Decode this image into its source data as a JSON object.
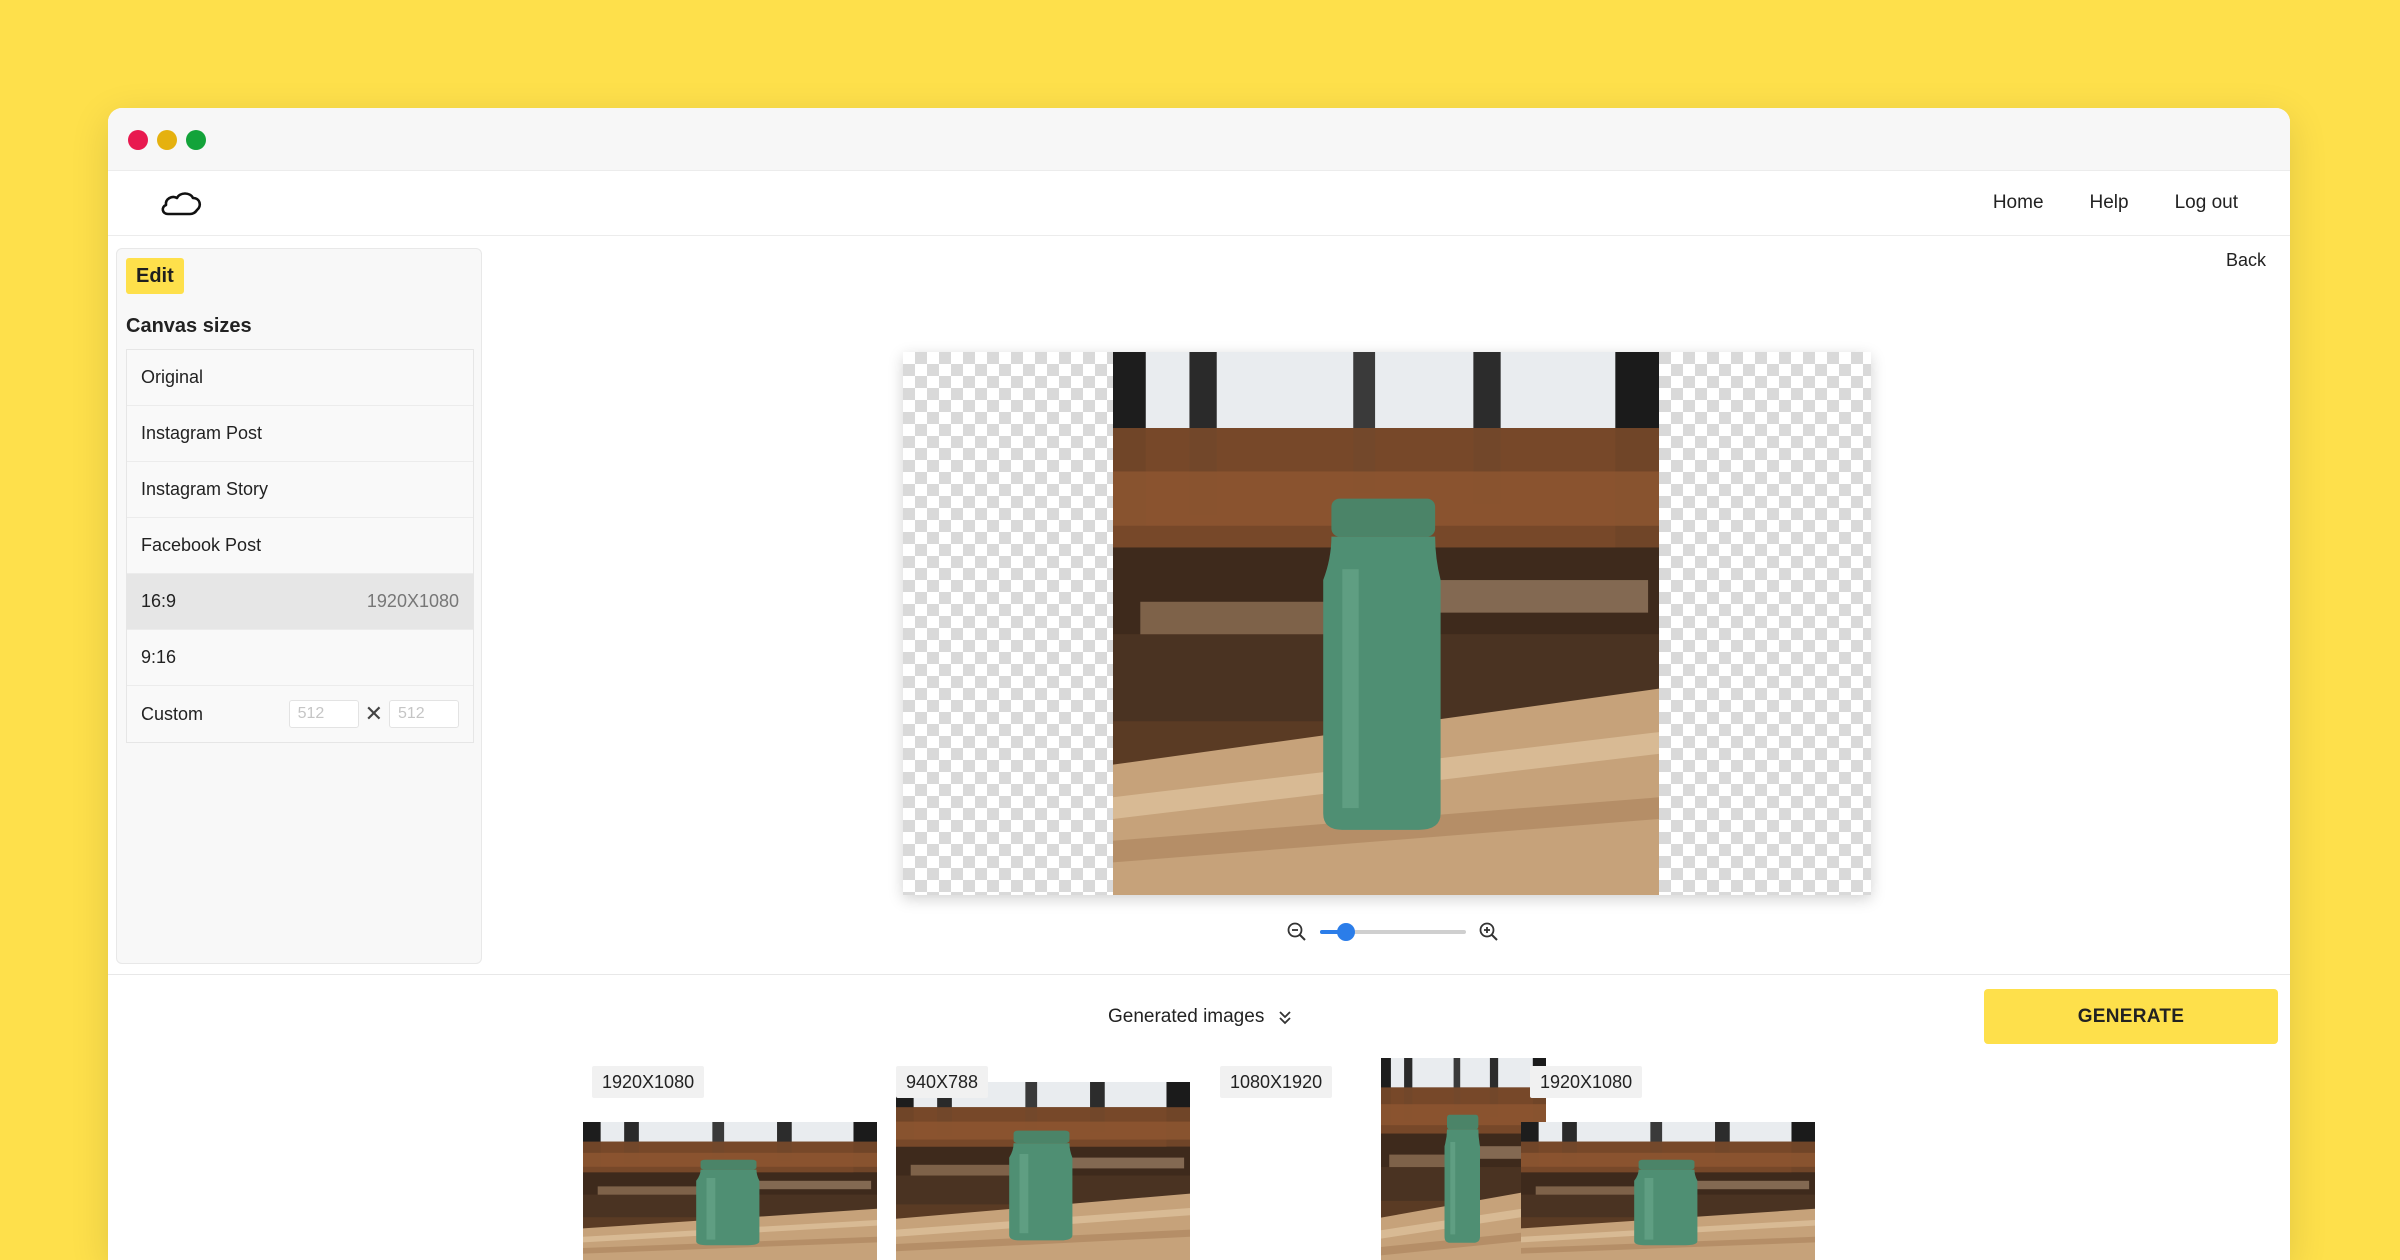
{
  "nav": {
    "home": "Home",
    "help": "Help",
    "logout": "Log out",
    "back": "Back"
  },
  "sidebar": {
    "edit_label": "Edit",
    "title": "Canvas sizes",
    "sizes": [
      {
        "label": "Original",
        "dim": ""
      },
      {
        "label": "Instagram Post",
        "dim": ""
      },
      {
        "label": "Instagram Story",
        "dim": ""
      },
      {
        "label": "Facebook Post",
        "dim": ""
      },
      {
        "label": "16:9",
        "dim": "1920X1080"
      },
      {
        "label": "9:16",
        "dim": ""
      },
      {
        "label": "Custom",
        "dim": ""
      }
    ],
    "selected_index": 4,
    "custom": {
      "width_placeholder": "512",
      "height_placeholder": "512"
    }
  },
  "zoom": {
    "level": 0.18
  },
  "generated": {
    "label": "Generated images",
    "button": "GENERATE"
  },
  "thumbnails": [
    {
      "label": "1920X1080"
    },
    {
      "label": "940X788"
    },
    {
      "label": "1080X1920"
    },
    {
      "label": "1920X1080"
    }
  ],
  "colors": {
    "accent": "#FEE04B",
    "slider": "#2b7de9",
    "bottle": "#4f8f73"
  }
}
